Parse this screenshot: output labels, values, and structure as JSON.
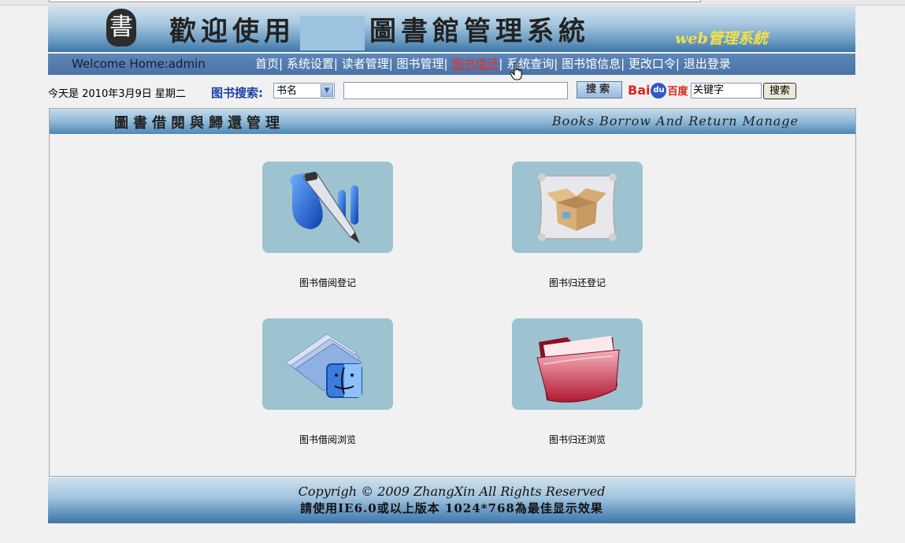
{
  "header": {
    "logo_glyph": "書",
    "title_left": "歡迎使用",
    "title_right": "圖書館管理系統",
    "subtitle": "web管理系統"
  },
  "nav": {
    "welcome": "Welcome Home:admin",
    "items": [
      {
        "label": "首页",
        "active": false
      },
      {
        "label": "系统设置",
        "active": false
      },
      {
        "label": "读者管理",
        "active": false
      },
      {
        "label": "图书管理",
        "active": false
      },
      {
        "label": "图书借还",
        "active": true
      },
      {
        "label": "系统查询",
        "active": false
      },
      {
        "label": "图书馆信息",
        "active": false
      },
      {
        "label": "更改口令",
        "active": false
      },
      {
        "label": "退出登录",
        "active": false
      }
    ]
  },
  "toolbar": {
    "date": "今天是 2010年3月9日 星期二",
    "search_label": "图书搜索:",
    "search_field_selected": "书名",
    "search_button": "搜索",
    "baidu_bai": "Bai",
    "baidu_paw": "du",
    "baidu_du": "百度",
    "keyword_value": "关键字",
    "keyword_button": "搜索"
  },
  "panel": {
    "title_cn": "圖書借閱與歸還管理",
    "title_en": "Books Borrow And Return Manage",
    "tiles": [
      {
        "label": "图书借阅登记",
        "icon": "pen-icon"
      },
      {
        "label": "图书归还登记",
        "icon": "box-icon"
      },
      {
        "label": "图书借阅浏览",
        "icon": "documents-finder-icon"
      },
      {
        "label": "图书归还浏览",
        "icon": "red-folder-icon"
      }
    ]
  },
  "footer": {
    "line1": "Copyrigh © 2009 ZhangXin    All Rights Reserved",
    "line2": "請使用IE6.0或以上版本 1024*768為最佳显示效果"
  },
  "colors": {
    "nav_bg": "#4b73a6",
    "nav_active": "#e03030",
    "tile_bg": "#9dc3d1",
    "search_label": "#1b3fa8",
    "subtitle": "#f4e04a"
  }
}
